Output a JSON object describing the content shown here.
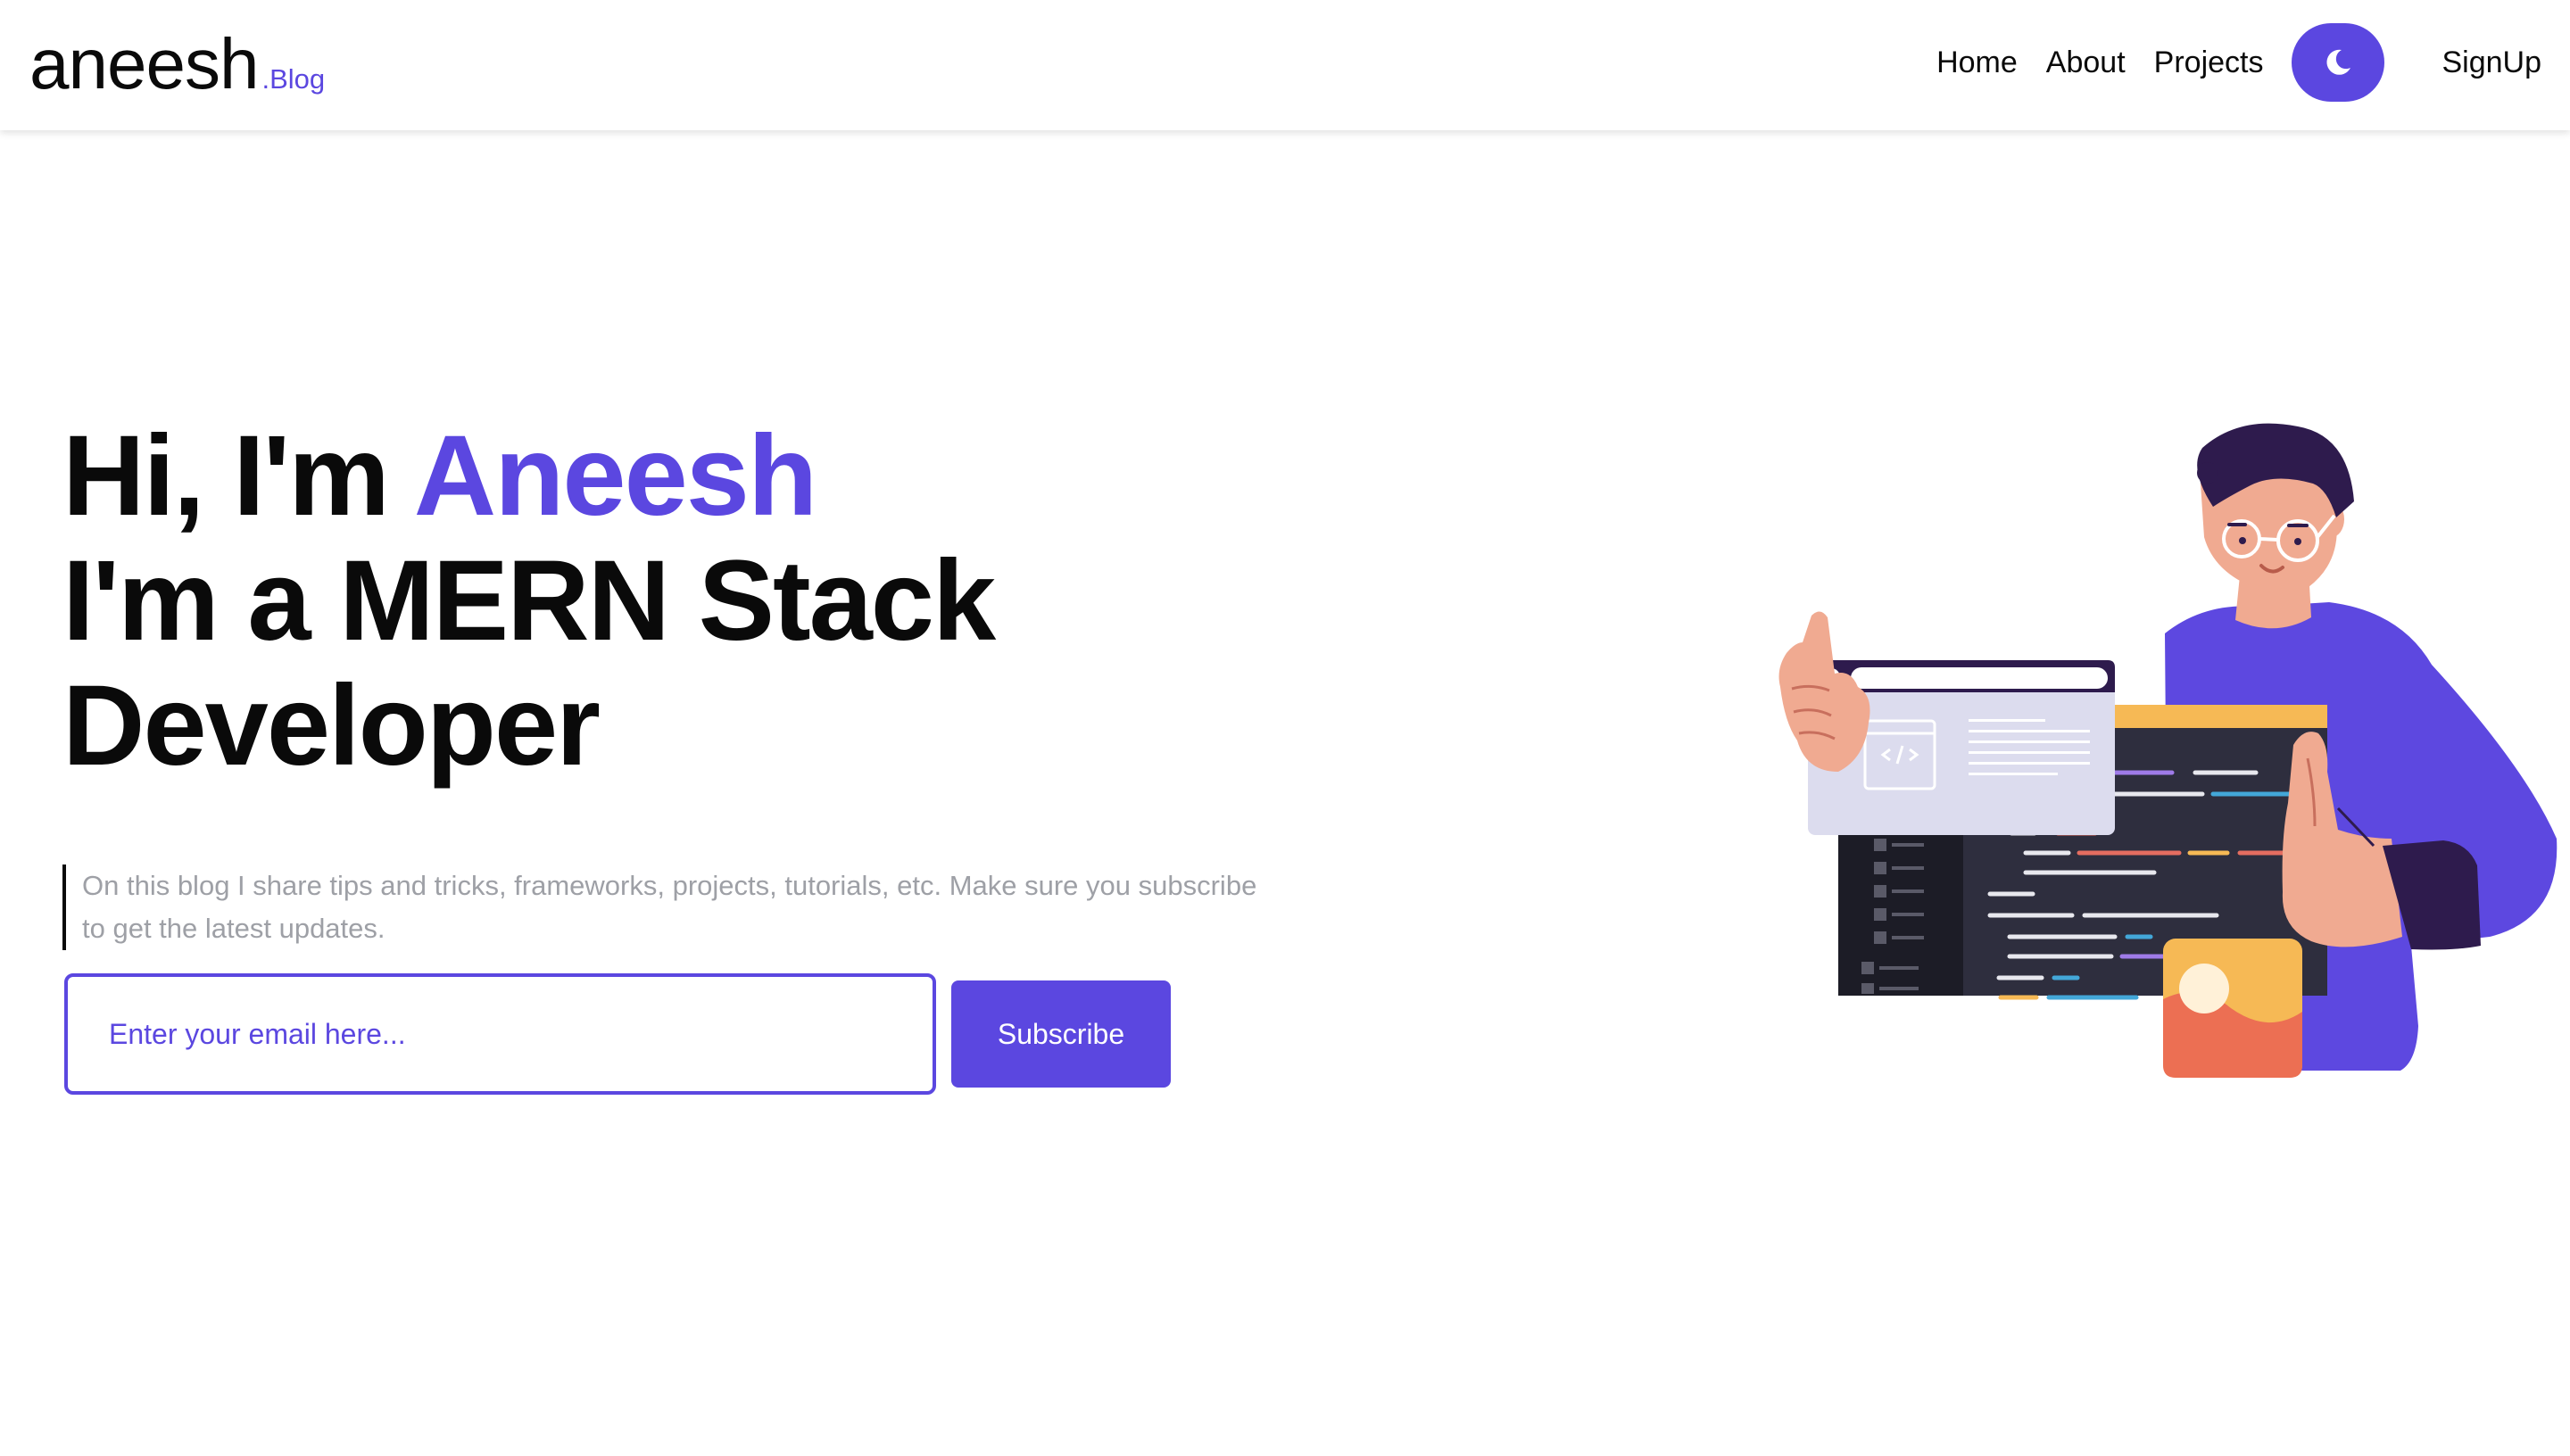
{
  "brand": {
    "name": "aneesh",
    "suffix": ".Blog"
  },
  "nav": {
    "links": [
      "Home",
      "About",
      "Projects"
    ],
    "theme_toggle_icon": "moon-icon",
    "signup_label": "SignUp"
  },
  "hero": {
    "greeting": "Hi, I'm ",
    "name": "Aneesh",
    "role_line1": "I'm a MERN Stack",
    "role_line2": "Developer",
    "description": "On this blog I share tips and tricks, frameworks, projects, tutorials, etc. Make sure you subscribe to get the latest updates."
  },
  "subscribe": {
    "placeholder": "Enter your email here...",
    "button_label": "Subscribe"
  },
  "illustration": "developer-holding-code-window-illustration",
  "colors": {
    "accent": "#5b47e0",
    "text": "#0a0a0a",
    "muted": "#9ea0a6"
  }
}
